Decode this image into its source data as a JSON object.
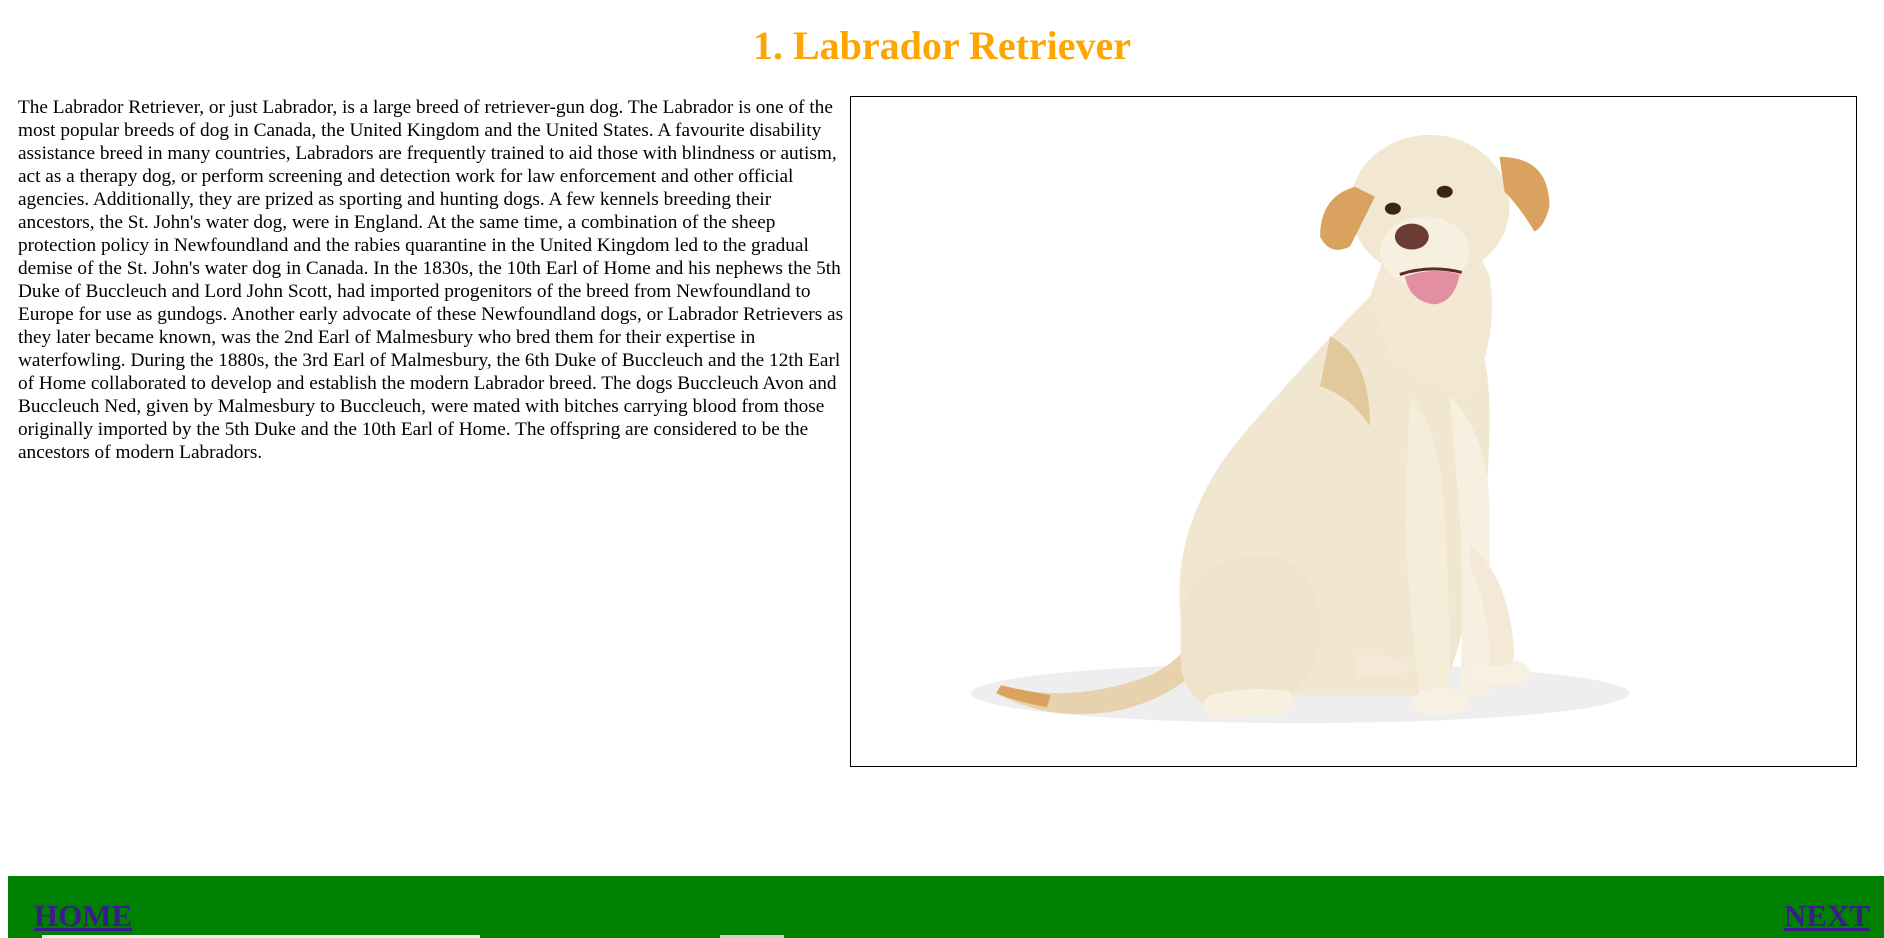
{
  "page": {
    "title": "1. Labrador Retriever",
    "title_color": "#ffa500"
  },
  "article": {
    "text": "The Labrador Retriever, or just Labrador, is a large breed of retriever-gun dog. The Labrador is one of the most popular breeds of dog in Canada, the United Kingdom and the United States. A favourite disability assistance breed in many countries, Labradors are frequently trained to aid those with blindness or autism, act as a therapy dog, or perform screening and detection work for law enforcement and other official agencies. Additionally, they are prized as sporting and hunting dogs. A few kennels breeding their ancestors, the St. John's water dog, were in England. At the same time, a combination of the sheep protection policy in Newfoundland and the rabies quarantine in the United Kingdom led to the gradual demise of the St. John's water dog in Canada. In the 1830s, the 10th Earl of Home and his nephews the 5th Duke of Buccleuch and Lord John Scott, had imported progenitors of the breed from Newfoundland to Europe for use as gundogs. Another early advocate of these Newfoundland dogs, or Labrador Retrievers as they later became known, was the 2nd Earl of Malmesbury who bred them for their expertise in waterfowling. During the 1880s, the 3rd Earl of Malmesbury, the 6th Duke of Buccleuch and the 12th Earl of Home collaborated to develop and establish the modern Labrador breed. The dogs Buccleuch Avon and Buccleuch Ned, given by Malmesbury to Buccleuch, were mated with bitches carrying blood from those originally imported by the 5th Duke and the 10th Earl of Home. The offspring are considered to be the ancestors of modern Labradors."
  },
  "image": {
    "subject": "labrador-retriever-dog",
    "fur_color": "#efe2c8",
    "ear_color": "#d9a25f"
  },
  "footer": {
    "background": "#008000",
    "home_label": "HOME",
    "next_label": "NEXT",
    "link_color": "#3b1c8c"
  }
}
